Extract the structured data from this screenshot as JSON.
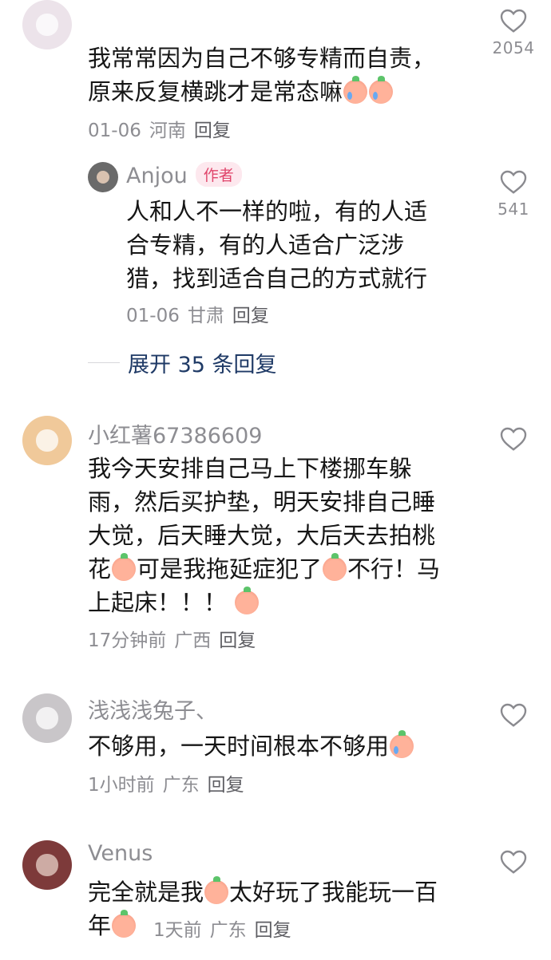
{
  "comments": [
    {
      "username": "",
      "text_lines": [
        "我常常因为自己不够专精而自责，",
        "原来反复横跳才是常态嘛"
      ],
      "emojis": [
        "crying-face-emoji",
        "crying-face-emoji"
      ],
      "date": "01-06",
      "location": "河南",
      "reply_label": "回复",
      "likes": "2054",
      "avatar_color": "#ece3ea"
    },
    {
      "username": "小红薯67386609",
      "text_lines": [
        "我今天安排自己马上下楼挪车躲",
        "雨，然后买护垫，明天安排自己睡",
        "大觉，后天睡大觉，大后天去拍桃",
        "花",
        "可是我拖延症犯了",
        "不行！马",
        "上起床！！！"
      ],
      "date": "17分钟前",
      "location": "广西",
      "reply_label": "回复",
      "likes": "",
      "avatar_color": "#f0c99a"
    },
    {
      "username": "浅浅浅兔子、",
      "text_lines": [
        "不够用，一天时间根本不够用"
      ],
      "date": "1小时前",
      "location": "广东",
      "reply_label": "回复",
      "likes": "",
      "avatar_color": "#c9c6c9"
    },
    {
      "username": "Venus",
      "text_lines": [
        "完全就是我",
        "太好玩了我能玩一百",
        "年"
      ],
      "date": "1天前",
      "location": "广东",
      "reply_label": "回复",
      "likes": "",
      "avatar_color": "#7d3a3a"
    }
  ],
  "author_reply": {
    "username": "Anjou",
    "badge": "作者",
    "text_lines": [
      "人和人不一样的啦，有的人适",
      "合专精，有的人适合广泛涉",
      "猎，找到适合自己的方式就行"
    ],
    "date": "01-06",
    "location": "甘肃",
    "reply_label": "回复",
    "likes": "541",
    "avatar_color": "#6a6a6a"
  },
  "expand_replies": "展开 35 条回复",
  "colors": {
    "text": "#161616",
    "meta": "#8d8d92",
    "expand": "#1f3a66",
    "badge": "#e0456b",
    "badge_bg": "#fde8ee"
  }
}
